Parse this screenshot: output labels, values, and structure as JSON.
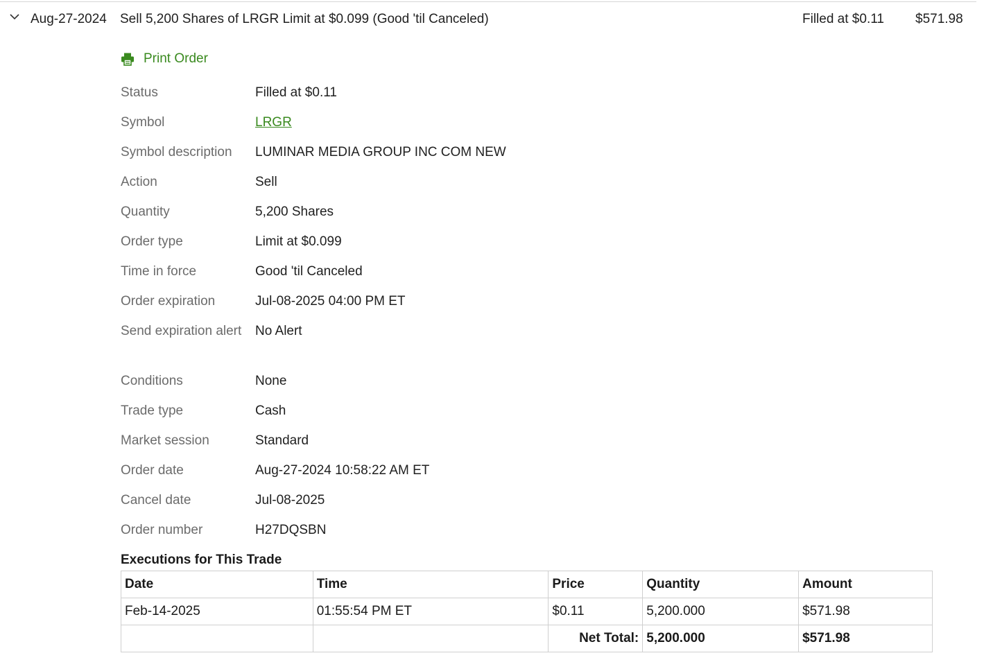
{
  "summary": {
    "date": "Aug-27-2024",
    "description": "Sell 5,200 Shares of LRGR Limit at $0.099 (Good 'til Canceled)",
    "status": "Filled at $0.11",
    "amount": "$571.98",
    "chevron_icon": "chevron-down-icon"
  },
  "print_order": {
    "label": "Print Order",
    "icon": "printer-icon",
    "color": "#3a8a1f"
  },
  "details": [
    {
      "label": "Status",
      "value": "Filled at $0.11"
    },
    {
      "label": "Symbol",
      "value": "LRGR"
    },
    {
      "label": "Symbol description",
      "value": "LUMINAR MEDIA GROUP INC COM NEW"
    },
    {
      "label": "Action",
      "value": "Sell"
    },
    {
      "label": "Quantity",
      "value": "5,200 Shares"
    },
    {
      "label": "Order type",
      "value": "Limit at $0.099"
    },
    {
      "label": "Time in force",
      "value": "Good 'til Canceled"
    },
    {
      "label": "Order expiration",
      "value": "Jul-08-2025 04:00 PM ET"
    },
    {
      "label": "Send expiration alert",
      "value": "No Alert"
    },
    {
      "label": "Conditions",
      "value": "None"
    },
    {
      "label": "Trade type",
      "value": "Cash"
    },
    {
      "label": "Market session",
      "value": "Standard"
    },
    {
      "label": "Order date",
      "value": "Aug-27-2024 10:58:22 AM ET"
    },
    {
      "label": "Cancel date",
      "value": "Jul-08-2025"
    },
    {
      "label": "Order number",
      "value": "H27DQSBN"
    }
  ],
  "executions": {
    "title": "Executions for This Trade",
    "headers": [
      "Date",
      "Time",
      "Price",
      "Quantity",
      "Amount"
    ],
    "rows": [
      [
        "Feb-14-2025",
        "01:55:54 PM ET",
        "$0.11",
        "5,200.000",
        "$571.98"
      ]
    ],
    "net_total_label": "Net Total:",
    "net_total_quantity": "5,200.000",
    "net_total_amount": "$571.98"
  }
}
